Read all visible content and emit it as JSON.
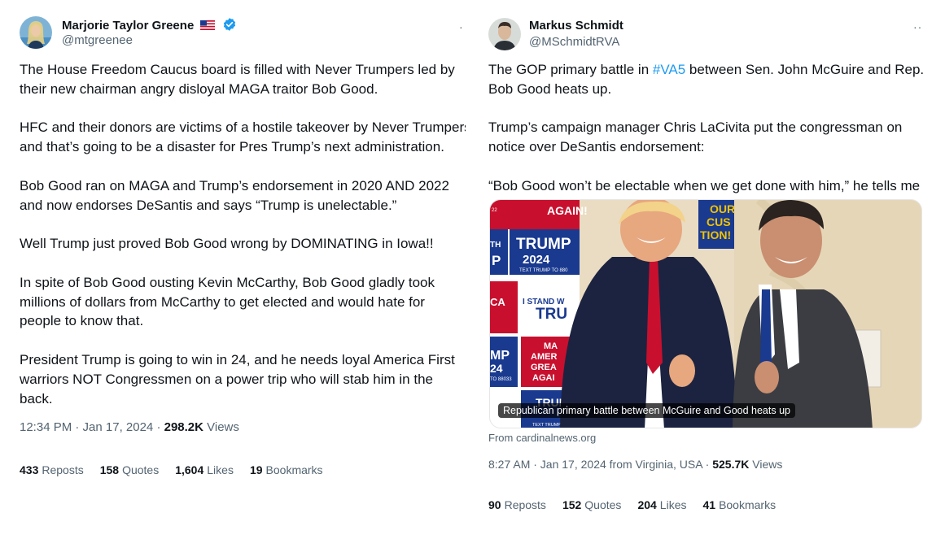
{
  "left": {
    "name": "Marjorie Taylor Greene",
    "handle": "@mtgreenee",
    "more": "·",
    "paragraphs": [
      [
        "The House Freedom Caucus board is filled with Never Trumpers led by",
        "their new chairman angry disloyal MAGA traitor Bob Good."
      ],
      [
        "HFC and their donors are victims of a hostile takeover by Never Trumpers",
        "and that’s going to be a disaster for Pres Trump’s next administration."
      ],
      [
        "Bob Good ran on MAGA and Trump’s endorsement in 2020 AND 2022",
        "and now endorses DeSantis and says “Trump is unelectable.”"
      ],
      [
        "Well Trump just proved Bob Good wrong by DOMINATING in Iowa!!"
      ],
      [
        "In spite of Bob Good ousting Kevin McCarthy, Bob Good gladly took",
        "millions of dollars from McCarthy to get elected and would hate for",
        "people to know that."
      ],
      [
        "President Trump is going to win in 24, and he needs loyal America First",
        "warriors NOT Congressmen on a power trip who will stab him in the",
        "back."
      ]
    ],
    "time": "12:34 PM · Jan 17, 2024 · ",
    "views_count": "298.2K",
    "views_label": " Views",
    "stats": {
      "reposts": {
        "count": "433",
        "label": "Reposts"
      },
      "quotes": {
        "count": "158",
        "label": "Quotes"
      },
      "likes": {
        "count": "1,604",
        "label": "Likes"
      },
      "bookmarks": {
        "count": "19",
        "label": "Bookmarks"
      }
    }
  },
  "right": {
    "name": "Markus Schmidt",
    "handle": "@MSchmidtRVA",
    "more": "··",
    "p1_before": "The GOP primary battle in ",
    "p1_hashtag": "#VA5",
    "p1_after": " between Sen. John McGuire and Rep.",
    "p1_line2": "Bob Good heats up.",
    "p2_line1": "Trump’s campaign manager Chris LaCivita put the congressman on",
    "p2_line2": "notice over DeSantis endorsement:",
    "p3": "“Bob Good won’t be electable when we get done with him,” he tells me",
    "card_caption": "Republican primary battle between McGuire and Good heats up",
    "card_from": "From cardinalnews.org",
    "sign_text": {
      "again": "AGAIN!",
      "trump": "TRUMP",
      "year": "2024",
      "text_trump": "TEXT TRUMP TO 880",
      "i_stand": "I STAND W",
      "tru": "TRU",
      "your": "OUR",
      "cus": "CUS",
      "tion": "TION!",
      "mp": "MP",
      "num24": "24",
      "ca": "CA",
      "ama": "MA",
      "ame": "AMER",
      "grea": "GREA",
      "agai": "AGAI",
      "trum": "TRUM",
      "th": "TH",
      "p": "P",
      "num22": "22",
      "to88033": "TO 88033",
      "text_trump_tc": "TEXT TRUMP TC"
    },
    "time": "8:27 AM · Jan 17, 2024 from Virginia, USA · ",
    "views_count": "525.7K",
    "views_label": " Views",
    "stats": {
      "reposts": {
        "count": "90",
        "label": "Reposts"
      },
      "quotes": {
        "count": "152",
        "label": "Quotes"
      },
      "likes": {
        "count": "204",
        "label": "Likes"
      },
      "bookmarks": {
        "count": "41",
        "label": "Bookmarks"
      }
    }
  },
  "colors": {
    "text": "#0f1419",
    "secondary": "#536471",
    "link": "#1d9bf0",
    "verified": "#1d9bf0",
    "sign_blue": "#1a3a8f",
    "sign_red": "#c8102e"
  }
}
